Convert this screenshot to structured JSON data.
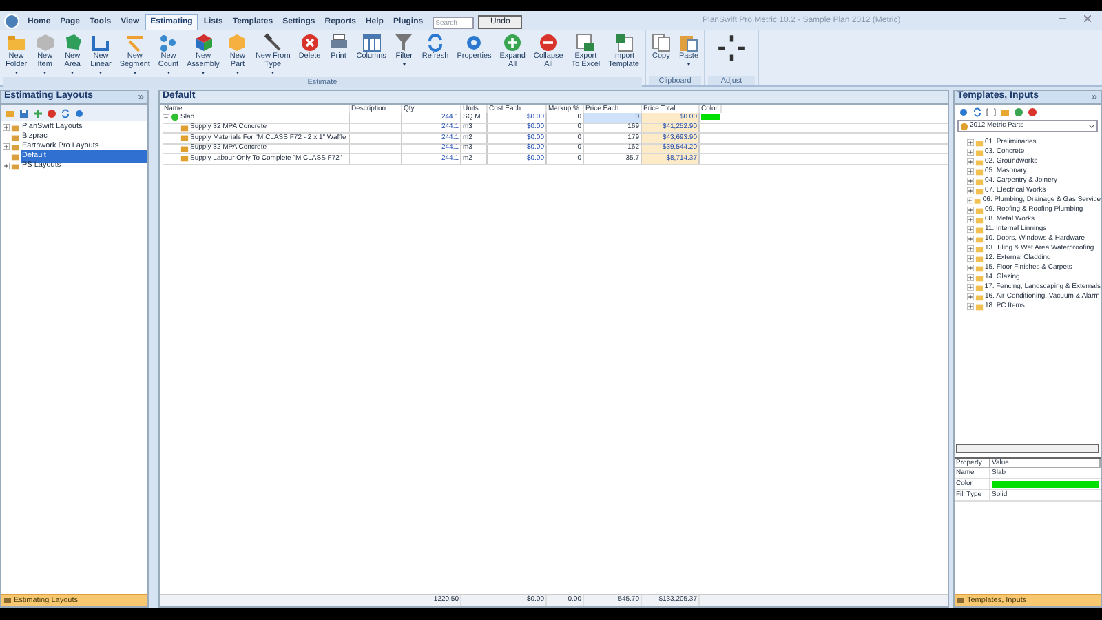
{
  "window": {
    "title": "PlanSwift Pro Metric 10.2 - Sample Plan 2012 (Metric)"
  },
  "menu_tabs": [
    {
      "label": "Home",
      "selected": false
    },
    {
      "label": "Page",
      "selected": false
    },
    {
      "label": "Tools",
      "selected": false
    },
    {
      "label": "View",
      "selected": false
    },
    {
      "label": "Estimating",
      "selected": true
    },
    {
      "label": "Lists",
      "selected": false
    },
    {
      "label": "Templates",
      "selected": false
    },
    {
      "label": "Settings",
      "selected": false
    },
    {
      "label": "Reports",
      "selected": false
    },
    {
      "label": "Help",
      "selected": false
    },
    {
      "label": "Plugins",
      "selected": false
    }
  ],
  "search": {
    "placeholder": "Search"
  },
  "undo_button": "Undo",
  "ribbon_groups": [
    {
      "label": "Estimate",
      "buttons": [
        {
          "lines": [
            "New",
            "Folder"
          ],
          "arrow": "▾"
        },
        {
          "lines": [
            "New",
            "Item"
          ],
          "arrow": "▾"
        },
        {
          "lines": [
            "New",
            "Area"
          ],
          "arrow": "▾"
        },
        {
          "lines": [
            "New",
            "Linear"
          ],
          "arrow": "▾"
        },
        {
          "lines": [
            "New",
            "Segment"
          ],
          "arrow": "▾"
        },
        {
          "lines": [
            "New",
            "Count"
          ],
          "arrow": "▾"
        },
        {
          "lines": [
            "New",
            "Assembly"
          ],
          "arrow": "▾"
        },
        {
          "lines": [
            "New",
            "Part"
          ],
          "arrow": "▾"
        },
        {
          "lines": [
            "New From",
            "Type"
          ],
          "arrow": "▾"
        },
        {
          "lines": [
            "Delete"
          ]
        },
        {
          "lines": [
            "Print"
          ]
        },
        {
          "lines": [
            "Columns"
          ]
        },
        {
          "lines": [
            "Filter"
          ],
          "arrow": "▾"
        },
        {
          "lines": [
            "Refresh"
          ]
        },
        {
          "lines": [
            "Properties"
          ]
        },
        {
          "lines": [
            "Expand",
            "All"
          ]
        },
        {
          "lines": [
            "Collapse",
            "All"
          ]
        },
        {
          "lines": [
            "Export",
            "To Excel"
          ]
        },
        {
          "lines": [
            "Import",
            "Template"
          ]
        }
      ]
    },
    {
      "label": "Clipboard",
      "buttons": [
        {
          "lines": [
            "Copy"
          ]
        },
        {
          "lines": [
            "Paste"
          ],
          "arrow": "▾"
        }
      ]
    },
    {
      "label": "Adjust"
    }
  ],
  "left_panel": {
    "title": "Estimating Layouts",
    "footer": "Estimating Layouts",
    "tree": [
      {
        "label": "PlanSwift Layouts",
        "collapsed": true,
        "selected": false
      },
      {
        "label": "Bizprac",
        "collapsed": false,
        "selected": false
      },
      {
        "label": "Earthwork Pro Layouts",
        "collapsed": true,
        "selected": false
      },
      {
        "label": "Default",
        "collapsed": false,
        "selected": true
      },
      {
        "label": "PS Layouts",
        "collapsed": true,
        "selected": false
      }
    ]
  },
  "estimate": {
    "title": "Default",
    "columns": [
      "Name",
      "Description",
      "Qty",
      "Units",
      "Cost Each",
      "Markup %",
      "Price Each",
      "Price Total",
      "Color"
    ],
    "rows": [
      {
        "name": "Slab",
        "expanded": true,
        "qty": "244.1",
        "units": "SQ M",
        "cost_each": "$0.00",
        "markup": "0",
        "price_each": "0",
        "price_total": "$0.00",
        "color": "#00e000",
        "children": [
          {
            "name": "Supply 32 MPA Concrete",
            "qty": "244.1",
            "units": "m3",
            "cost_each": "$0.00",
            "markup": "0",
            "price_each": "169",
            "price_total": "$41,252.90"
          },
          {
            "name": "Supply Materials For \"M CLASS F72 - 2 x 1\"  Waffle",
            "qty": "244.1",
            "units": "m2",
            "cost_each": "$0.00",
            "markup": "0",
            "price_each": "179",
            "price_total": "$43,693.90"
          },
          {
            "name": "Supply 32 MPA Concrete",
            "qty": "244.1",
            "units": "m3",
            "cost_each": "$0.00",
            "markup": "0",
            "price_each": "162",
            "price_total": "$39,544.20"
          },
          {
            "name": "Supply Labour Only To Complete \"M CLASS F72\"",
            "qty": "244.1",
            "units": "m2",
            "cost_each": "$0.00",
            "markup": "0",
            "price_each": "35.7",
            "price_total": "$8,714.37"
          }
        ]
      }
    ],
    "totals": {
      "qty": "1220.50",
      "cost_each": "$0.00",
      "markup": "0.00",
      "price_each": "545.70",
      "price_total": "$133,205.37"
    }
  },
  "right_panel": {
    "title": "Templates, Inputs",
    "footer": "Templates, Inputs",
    "dropdown": "2012 Metric Parts",
    "folders": [
      "01. Preliminaries",
      "03. Concrete",
      "02. Groundworks",
      "05. Masonary",
      "04. Carpentry & Joinery",
      "07. Electrical Works",
      "06. Plumbing, Drainage & Gas Service",
      "09. Roofing & Roofing Plumbing",
      "08. Metal Works",
      "11. Internal Linnings",
      "10. Doors, Windows & Hardware",
      "13. Tiling & Wet Area Waterproofing",
      "12. External Cladding",
      "15. Floor Finishes & Carpets",
      "14. Glazing",
      "17. Fencing, Landscaping & Externals",
      "16. Air-Conditioning, Vacuum & Alarm",
      "18. PC Items"
    ],
    "properties": {
      "columns": [
        "Property",
        "Value"
      ],
      "rows": [
        {
          "kind": "text",
          "name": "Name",
          "value": "Slab"
        },
        {
          "kind": "color",
          "name": "Color",
          "color": "#00e000"
        },
        {
          "kind": "text",
          "name": "Fill Type",
          "value": "Solid"
        }
      ]
    }
  }
}
